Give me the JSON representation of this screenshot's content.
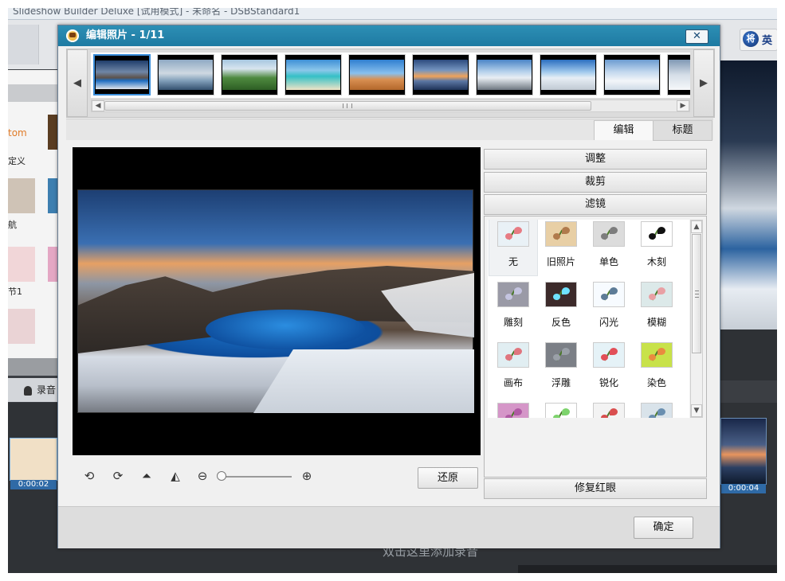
{
  "background_app": {
    "window_title": "Slideshow Builder Deluxe [试用模式] - 未命名 - DSBStandard1",
    "left_panel_texts": [
      "tom",
      "定义",
      "航",
      "节1"
    ],
    "record_label": "录音",
    "add_audio_hint": "双击这里添加录音",
    "clip1_time": "0:00:02",
    "clip2_time": "0:00:04",
    "logo_char": "将",
    "logo_text": "英"
  },
  "dialog": {
    "title": "编辑照片 - 1/11",
    "close_label": "✕",
    "prev_label": "◀",
    "next_label": "▶",
    "thumbnails": [
      "photo-1",
      "photo-2",
      "photo-3",
      "photo-4",
      "photo-5",
      "photo-6",
      "photo-7",
      "photo-8",
      "photo-9",
      "photo-10"
    ],
    "selected_thumbnail": "photo-1",
    "tabs": {
      "edit": "编辑",
      "title": "标题"
    },
    "active_tab": "编辑",
    "accordion": {
      "adjust": "调整",
      "crop": "裁剪",
      "filter": "滤镜"
    },
    "filters": [
      {
        "label": "无",
        "tint": "#e9f1f6",
        "flower": "#e77b83"
      },
      {
        "label": "旧照片",
        "tint": "#e8cfa5",
        "flower": "#b07a4c"
      },
      {
        "label": "单色",
        "tint": "#dcdcdc",
        "flower": "#7d7d7d"
      },
      {
        "label": "木刻",
        "tint": "#ffffff",
        "flower": "#111111"
      },
      {
        "label": "雕刻",
        "tint": "#9a9aa6",
        "flower": "#c4c4e0"
      },
      {
        "label": "反色",
        "tint": "#3c2a2a",
        "flower": "#6fe2ff"
      },
      {
        "label": "闪光",
        "tint": "#f7fbff",
        "flower": "#5d7c97"
      },
      {
        "label": "模糊",
        "tint": "#dce9e9",
        "flower": "#e9a0a4"
      },
      {
        "label": "画布",
        "tint": "#e1eef2",
        "flower": "#e0757e"
      },
      {
        "label": "浮雕",
        "tint": "#7b7f86",
        "flower": "#9aa0a8"
      },
      {
        "label": "锐化",
        "tint": "#e5f2f7",
        "flower": "#e24f58"
      },
      {
        "label": "染色",
        "tint": "#c8e24a",
        "flower": "#e98b3f"
      },
      {
        "label": "",
        "tint": "#d596c8",
        "flower": "#b05aa4"
      },
      {
        "label": "",
        "tint": "#ffffff",
        "flower": "#7dd36c"
      },
      {
        "label": "",
        "tint": "#f3f3f3",
        "flower": "#d94f4f"
      },
      {
        "label": "",
        "tint": "#d9e3ea",
        "flower": "#6a8fb0"
      }
    ],
    "selected_filter": "无",
    "redeye_label": "修复红眼",
    "restore_label": "还原",
    "ok_label": "确定",
    "toolbar_icons": {
      "rotate_left": "⟲",
      "rotate_right": "⟳",
      "flip_vertical": "⏶",
      "flip_horizontal": "◭",
      "zoom_out": "⊖",
      "zoom_in": "⊕"
    },
    "zoom_level": 0.0,
    "colors": {
      "title_bar": "#1e7aa2",
      "selection": "#3b8edb"
    }
  }
}
